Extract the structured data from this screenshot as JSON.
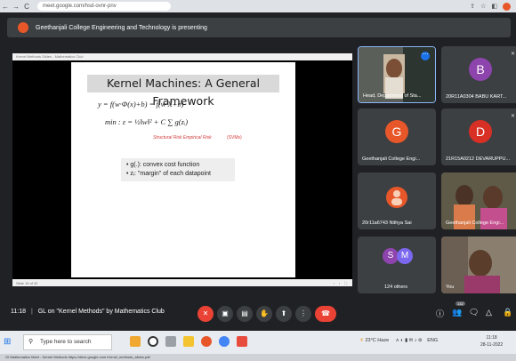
{
  "browser": {
    "url": "meet.google.com/hsd-ovnr-pnv"
  },
  "banner": {
    "text": "Geethanjali College Engineering and Technology is presenting"
  },
  "slide": {
    "toolbar_text": "Kernel Methods Slides - Mathematics Club",
    "title": "Kernel Machines: A General Framework",
    "eq1": "y = f(w·Φ(x)+b) = f(w·X+b)",
    "eq2": "min : ε = ½‖w‖² + C ∑ g(zᵢ)",
    "eq2_sub": "w, b",
    "risk_label": "Structural Risk   Empirical Risk",
    "svm_label": "(SVMs)",
    "bullets": [
      "• g(.): convex cost function",
      "• zᵢ: \"margin\" of each datapoint"
    ],
    "bottom_text": "Slide 15 of 32"
  },
  "participants": [
    {
      "name": "Head, Department of Sta...",
      "type": "photo"
    },
    {
      "name": "20R11A0304 BABU KART...",
      "initial": "B",
      "color": "#8e44ad"
    },
    {
      "name": "Geethanjali College Engi...",
      "initial": "G",
      "color": "#e8572a"
    },
    {
      "name": "21R15A0212 DEVARUPPU...",
      "initial": "D",
      "color": "#d93025"
    },
    {
      "name": "20r11a6743 Nithya Sai",
      "type": "photo"
    },
    {
      "name": "Geethanjali College Engi...",
      "type": "photo"
    },
    {
      "name": "124 others",
      "initials": [
        "S",
        "M"
      ]
    },
    {
      "name": "You",
      "type": "photo"
    }
  ],
  "meeting": {
    "time": "11:18",
    "title": "GL on \"Kernel Methods\" by Mathematics Club",
    "participants_badge": "132"
  },
  "taskbar": {
    "search_placeholder": "Type here to search",
    "weather": "23°C  Haze",
    "lang": "ENG",
    "time": "11:18",
    "date": "28-11-2022"
  },
  "tabs": "GI Mathematics   Meet - Kernel Methods   https://drive.google.com   Kernel_methods_slides.pdf"
}
